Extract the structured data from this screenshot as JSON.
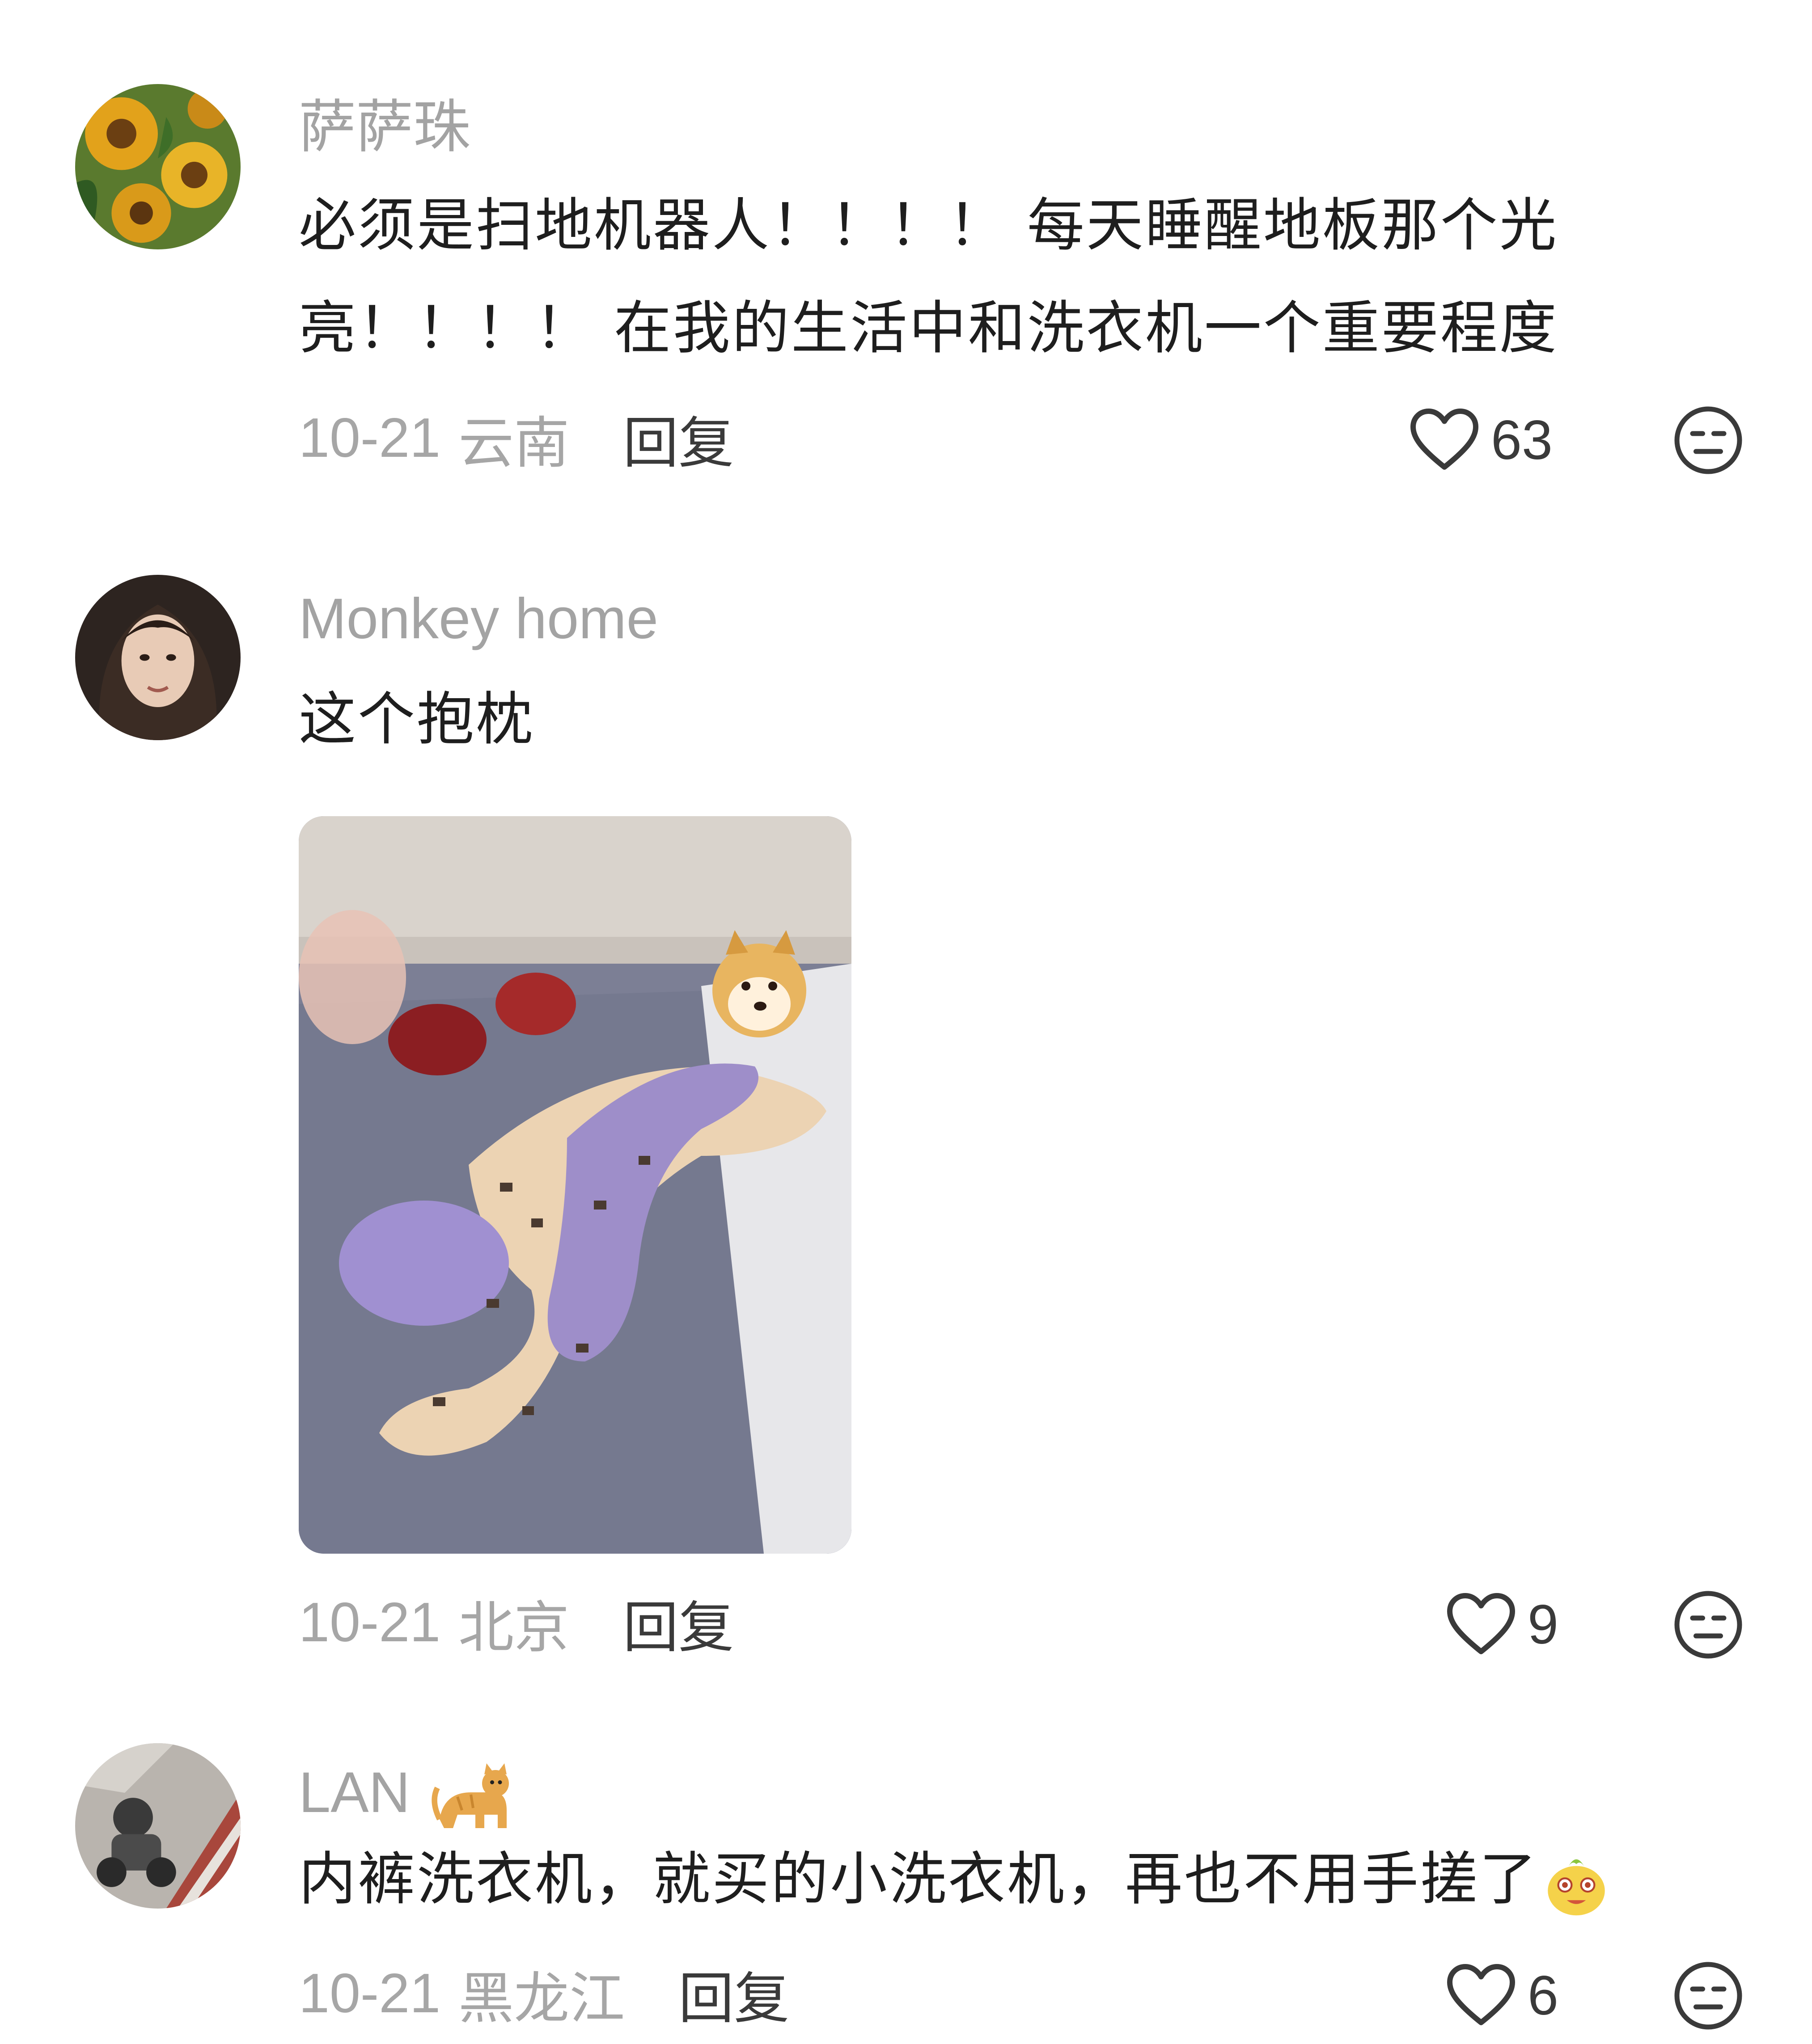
{
  "comments": [
    {
      "username": "萨萨珠",
      "text_lines": [
        "必须是扫地机器人！！！！ 每天睡醒地板那个光",
        "亮！！！！ 在我的生活中和洗衣机一个重要程度"
      ],
      "date": "10-21",
      "location": "云南",
      "reply_label": "回复",
      "likes": "63",
      "avatar_icon": "sunflower-avatar"
    },
    {
      "username": "Monkey home",
      "text_lines": [
        "这个抱枕"
      ],
      "date": "10-21",
      "location": "北京",
      "reply_label": "回复",
      "likes": "9",
      "avatar_icon": "woman-avatar",
      "photo_icon": "body-pillow-photo"
    },
    {
      "username": "LAN",
      "username_emoji": "cat-emoji",
      "text_lines": [
        "内裤洗衣机，就买的小洗衣机，再也不用手搓了"
      ],
      "text_emoji": "yellow-emoji",
      "date": "10-21",
      "location": "黑龙江",
      "reply_label": "回复",
      "likes": "6",
      "avatar_icon": "motorcycle-avatar"
    }
  ],
  "icons": {
    "like": "heart-outline-icon",
    "dislike": "meh-face-icon"
  },
  "colors": {
    "username": "#a3a3a3",
    "text": "#1e1e1e",
    "meta": "#a6a6a6",
    "reply": "#3a3a3a"
  }
}
